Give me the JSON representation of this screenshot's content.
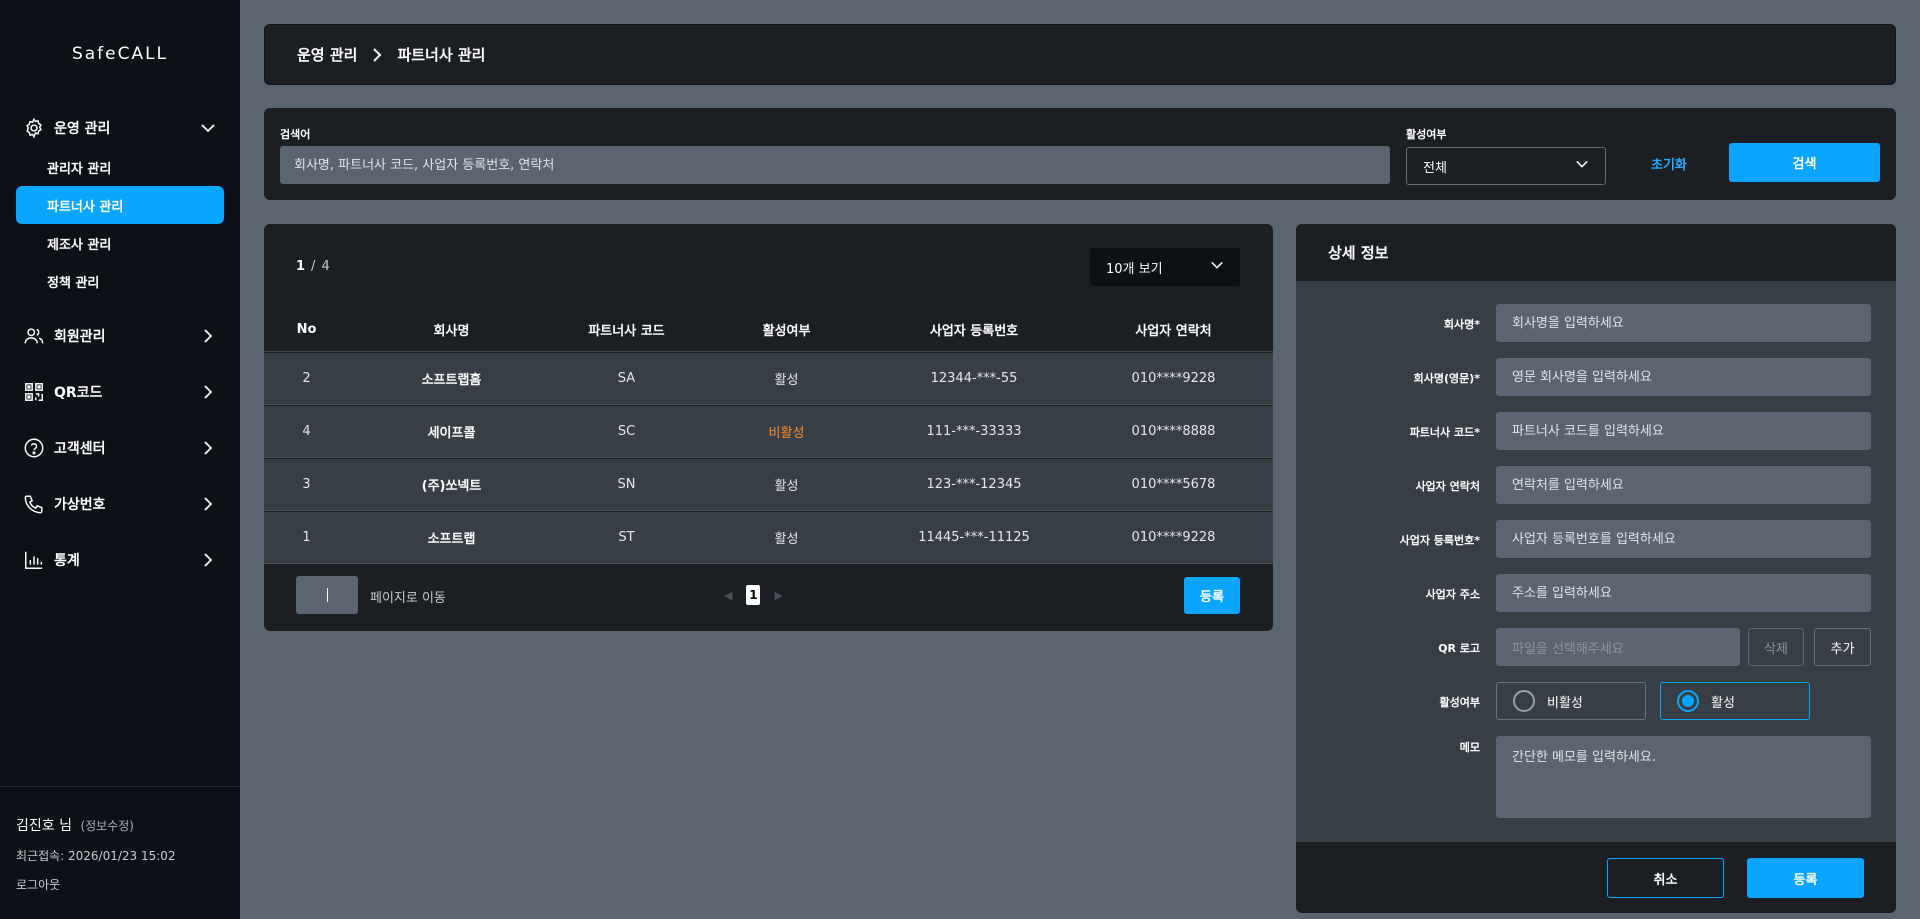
{
  "app": {
    "logo": "SafeCALL"
  },
  "sidebar": {
    "sections": [
      {
        "label": "운영 관리",
        "icon": "gear-icon",
        "expanded": true,
        "items": [
          {
            "label": "관리자 관리"
          },
          {
            "label": "파트너사 관리",
            "active": true
          },
          {
            "label": "제조사 관리"
          },
          {
            "label": "정책 관리"
          }
        ]
      },
      {
        "label": "회원관리",
        "icon": "users-icon"
      },
      {
        "label": "QR코드",
        "icon": "qr-icon"
      },
      {
        "label": "고객센터",
        "icon": "help-icon"
      },
      {
        "label": "가상번호",
        "icon": "phone-icon"
      },
      {
        "label": "통계",
        "icon": "chart-icon"
      }
    ],
    "user": {
      "name": "김진호 님",
      "edit_label": "(정보수정)",
      "last_login": "최근접속: 2026/01/23 15:02",
      "logout": "로그아웃"
    }
  },
  "breadcrumb": {
    "parent": "운영 관리",
    "current": "파트너사 관리"
  },
  "search": {
    "keyword_label": "검색어",
    "keyword_placeholder": "회사명, 파트너사 코드, 사업자 등록번호, 연락처",
    "status_label": "활성여부",
    "status_value": "전체",
    "reset_label": "초기화",
    "search_label": "검색"
  },
  "list": {
    "page_current": "1",
    "page_separator": "/",
    "page_total": "4",
    "page_size": "10개 보기",
    "columns": [
      "No",
      "회사명",
      "파트너사 코드",
      "활성여부",
      "사업자 등록번호",
      "사업자 연락처"
    ],
    "rows": [
      {
        "no": "2",
        "company": "소프트랩홈",
        "code": "SA",
        "status": "활성",
        "biz_no": "12344-***-55",
        "tel": "010****9228"
      },
      {
        "no": "4",
        "company": "세이프콜",
        "code": "SC",
        "status": "비활성",
        "biz_no": "111-***-33333",
        "tel": "010****8888"
      },
      {
        "no": "3",
        "company": "(주)쏘넥트",
        "code": "SN",
        "status": "활성",
        "biz_no": "123-***-12345",
        "tel": "010****5678"
      },
      {
        "no": "1",
        "company": "소프트랩",
        "code": "ST",
        "status": "활성",
        "biz_no": "11445-***-11125",
        "tel": "010****9228"
      }
    ],
    "goto_label": "페이지로 이동",
    "current_page": "1",
    "register_label": "등록"
  },
  "detail": {
    "title": "상세 정보",
    "fields": [
      {
        "label": "회사명*",
        "placeholder": "회사명을 입력하세요"
      },
      {
        "label": "회사명(영문)*",
        "placeholder": "영문 회사명을 입력하세요"
      },
      {
        "label": "파트너사 코드*",
        "placeholder": "파트너사 코드를 입력하세요"
      },
      {
        "label": "사업자 연락처",
        "placeholder": "연락처를 입력하세요"
      },
      {
        "label": "사업자 등록번호*",
        "placeholder": "사업자 등록번호를 입력하세요"
      },
      {
        "label": "사업자 주소",
        "placeholder": "주소를 입력하세요"
      }
    ],
    "qr_label": "QR 로고",
    "qr_placeholder": "파일을 선택해주세요",
    "qr_delete": "삭제",
    "qr_add": "추가",
    "status_label": "활성여부",
    "status_inactive": "비활성",
    "status_active": "활성",
    "status_selected": "활성",
    "memo_label": "메모",
    "memo_placeholder": "간단한 메모를 입력하세요.",
    "cancel_label": "취소",
    "save_label": "등록"
  },
  "colors": {
    "accent": "#0aa5ff",
    "inactive": "#ff8a2b",
    "panel": "#1b1f24",
    "sidebar": "#0d1117",
    "background": "#5b6471"
  }
}
